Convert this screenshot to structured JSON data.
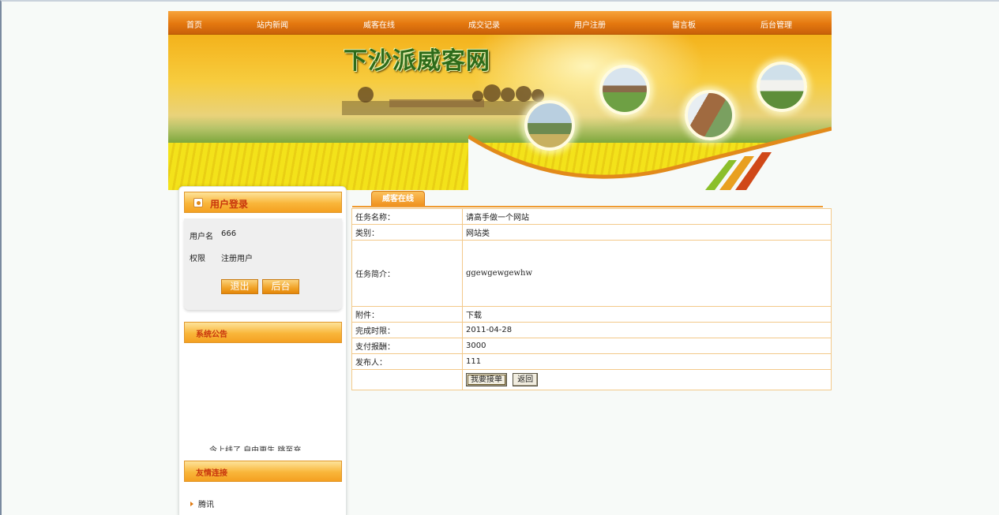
{
  "nav": {
    "items": [
      "首页",
      "站内新闻",
      "威客在线",
      "成交记录",
      "用户注册",
      "留言板",
      "后台管理"
    ]
  },
  "banner": {
    "title": "下沙派威客网"
  },
  "login": {
    "title": "用户登录",
    "username_label": "用户名",
    "username_value": "666",
    "role_label": "权限",
    "role_value": "注册用户",
    "logout_button": "退出",
    "admin_button": "后台"
  },
  "notice": {
    "title": "系统公告",
    "scroll_text": "今上线了 自由更生 跳至充"
  },
  "links": {
    "title": "友情连接",
    "items": [
      "腾讯"
    ]
  },
  "content": {
    "tab": "威客在线",
    "rows": [
      {
        "label": "任务名称：",
        "value": "请高手做一个网站"
      },
      {
        "label": "类别：",
        "value": "网站类"
      },
      {
        "label": "任务简介：",
        "value": "ggewgewgewhw"
      },
      {
        "label": "附件：",
        "value": "下载"
      },
      {
        "label": "完成时限：",
        "value": "2011-04-28"
      },
      {
        "label": "支付报酬：",
        "value": "3000"
      },
      {
        "label": "发布人：",
        "value": "111"
      }
    ],
    "accept_button": "我要接单",
    "back_button": "返回"
  },
  "colors": {
    "nav_orange": "#e4780f",
    "header_gradient": "#f9b63a",
    "heading_red": "#c8350d",
    "table_border": "#f3c98a"
  }
}
